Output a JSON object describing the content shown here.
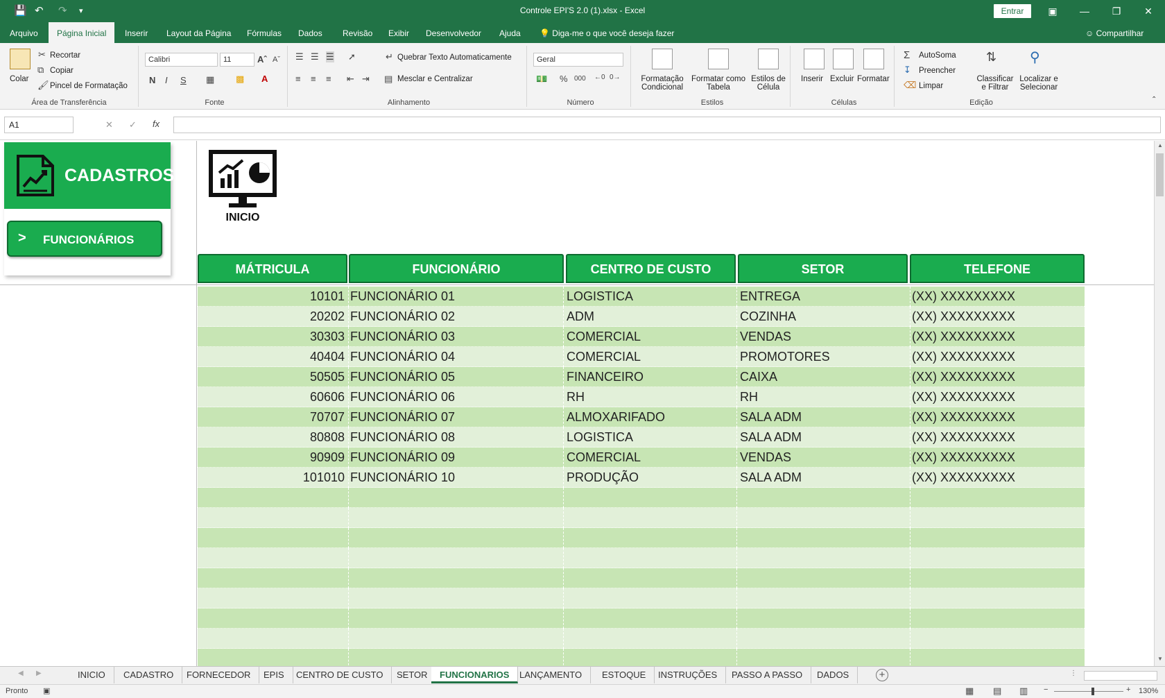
{
  "app": {
    "title": "Controle EPI'S 2.0 (1).xlsx  -  Excel",
    "signin_label": "Entrar"
  },
  "menu_tabs": [
    "Arquivo",
    "Página Inicial",
    "Inserir",
    "Layout da Página",
    "Fórmulas",
    "Dados",
    "Revisão",
    "Exibir",
    "Desenvolvedor",
    "Ajuda"
  ],
  "active_menu_tab": "Página Inicial",
  "tell_me": "Diga-me o que você deseja fazer",
  "share_label": "Compartilhar",
  "ribbon": {
    "clipboard": {
      "group": "Área de Transferência",
      "paste": "Colar",
      "cut": "Recortar",
      "copy": "Copiar",
      "format_painter": "Pincel de Formatação"
    },
    "font": {
      "group": "Fonte",
      "font_name": "Calibri",
      "font_size": "11",
      "bold": "N",
      "italic": "I",
      "underline": "S"
    },
    "alignment": {
      "group": "Alinhamento",
      "wrap": "Quebrar Texto Automaticamente",
      "merge": "Mesclar e Centralizar"
    },
    "number": {
      "group": "Número",
      "format": "Geral",
      "percent": "%",
      "thousands": "000"
    },
    "styles": {
      "group": "Estilos",
      "conditional": [
        "Formatação",
        "Condicional"
      ],
      "as_table": [
        "Formatar como",
        "Tabela"
      ],
      "cell_styles": [
        "Estilos de",
        "Célula"
      ]
    },
    "cells": {
      "group": "Células",
      "insert": "Inserir",
      "delete": "Excluir",
      "format": "Formatar"
    },
    "editing": {
      "group": "Edição",
      "autosum": "AutoSoma",
      "fill": "Preencher",
      "clear": "Limpar",
      "sort": [
        "Classificar",
        "e Filtrar"
      ],
      "find": [
        "Localizar e",
        "Selecionar"
      ]
    }
  },
  "formula_bar": {
    "name_box": "A1",
    "fx": "fx",
    "value": ""
  },
  "sheet": {
    "panel_title": "CADASTROS",
    "nav_button": "FUNCIONÁRIOS",
    "nav_chevron": ">",
    "home_label": "INICIO",
    "headers": [
      "MÁTRICULA",
      "FUNCIONÁRIO",
      "CENTRO DE CUSTO",
      "SETOR",
      "TELEFONE"
    ],
    "rows": [
      [
        "10101",
        "FUNCIONÁRIO 01",
        "LOGISTICA",
        "ENTREGA",
        "(XX) XXXXXXXXX"
      ],
      [
        "20202",
        "FUNCIONÁRIO 02",
        "ADM",
        "COZINHA",
        "(XX) XXXXXXXXX"
      ],
      [
        "30303",
        "FUNCIONÁRIO 03",
        "COMERCIAL",
        "VENDAS",
        "(XX) XXXXXXXXX"
      ],
      [
        "40404",
        "FUNCIONÁRIO 04",
        "COMERCIAL",
        "PROMOTORES",
        "(XX) XXXXXXXXX"
      ],
      [
        "50505",
        "FUNCIONÁRIO 05",
        "FINANCEIRO",
        "CAIXA",
        "(XX) XXXXXXXXX"
      ],
      [
        "60606",
        "FUNCIONÁRIO 06",
        "RH",
        "RH",
        "(XX) XXXXXXXXX"
      ],
      [
        "70707",
        "FUNCIONÁRIO 07",
        "ALMOXARIFADO",
        "SALA ADM",
        "(XX) XXXXXXXXX"
      ],
      [
        "80808",
        "FUNCIONÁRIO 08",
        "LOGISTICA",
        "SALA ADM",
        "(XX) XXXXXXXXX"
      ],
      [
        "90909",
        "FUNCIONÁRIO 09",
        "COMERCIAL",
        "VENDAS",
        "(XX) XXXXXXXXX"
      ],
      [
        "101010",
        "FUNCIONÁRIO 10",
        "PRODUÇÃO",
        "SALA ADM",
        "(XX) XXXXXXXXX"
      ]
    ],
    "empty_rows": 9
  },
  "sheet_tabs": [
    "INICIO",
    "CADASTRO",
    "FORNECEDOR",
    "EPIS",
    "CENTRO DE CUSTO",
    "SETOR",
    "FUNCIONARIOS",
    "LANÇAMENTO",
    "ESTOQUE",
    "INSTRUÇÕES",
    "PASSO A PASSO",
    "DADOS"
  ],
  "active_sheet": "FUNCIONARIOS",
  "status": {
    "ready": "Pronto",
    "zoom": "130%"
  },
  "colors": {
    "excel_green": "#217346",
    "brand_green": "#1aac4f",
    "row_band_a": "#c7e5b4",
    "row_band_b": "#e2f0d9"
  }
}
